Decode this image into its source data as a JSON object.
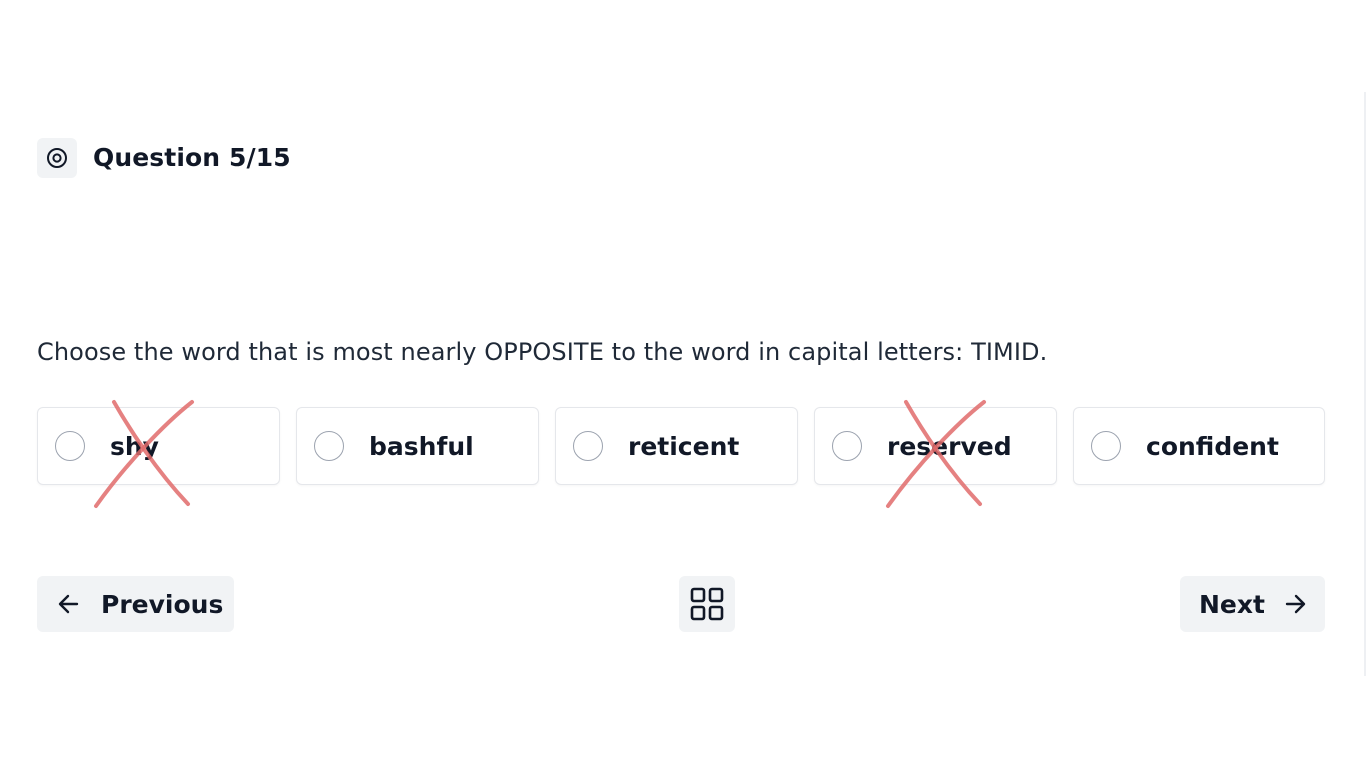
{
  "question": {
    "counter": "Question 5/15",
    "prompt": "Choose the word that is most nearly OPPOSITE to the word in capital letters: TIMID.",
    "icon": "target-icon"
  },
  "options": [
    {
      "label": "shy",
      "eliminated": true
    },
    {
      "label": "bashful",
      "eliminated": false
    },
    {
      "label": "reticent",
      "eliminated": false
    },
    {
      "label": "reserved",
      "eliminated": true
    },
    {
      "label": "confident",
      "eliminated": false
    }
  ],
  "nav": {
    "previous_label": "Previous",
    "next_label": "Next",
    "grid_icon": "grid-icon"
  },
  "colors": {
    "cross": "#e06b6b",
    "button_bg": "#f1f3f5",
    "text": "#111827"
  }
}
